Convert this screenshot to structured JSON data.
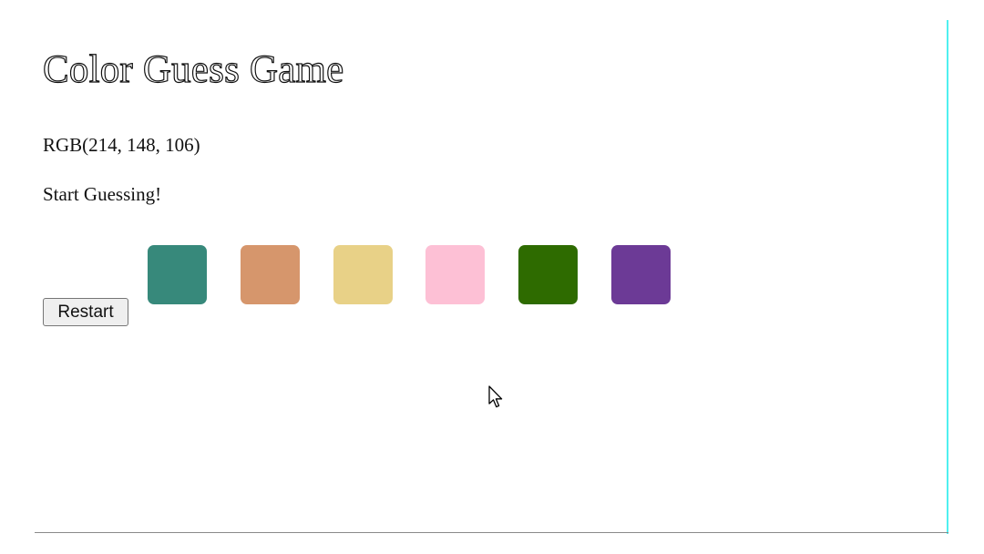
{
  "game": {
    "title": "Color Guess Game",
    "rgb_text": "RGB(214, 148, 106)",
    "message": "Start Guessing!",
    "restart_label": "Restart"
  },
  "squares": [
    {
      "color": "#37897b"
    },
    {
      "color": "#d6966c"
    },
    {
      "color": "#e8d187"
    },
    {
      "color": "#fdc0d5"
    },
    {
      "color": "#2e6b00"
    },
    {
      "color": "#6c3a96"
    }
  ],
  "colors": {
    "right_border": "#4ff0f0",
    "bottom_border": "#8a8a8a",
    "text": "#111111"
  },
  "icons": {
    "cursor": "mouse-pointer-icon"
  }
}
